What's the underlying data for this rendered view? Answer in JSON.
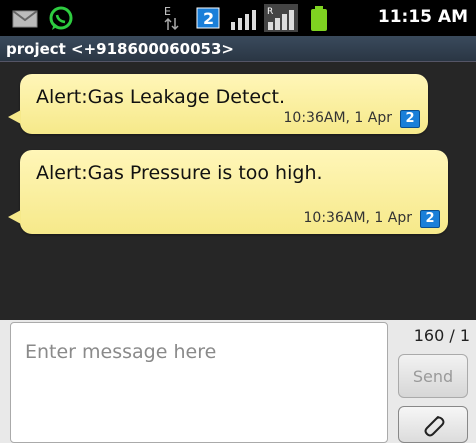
{
  "status_bar": {
    "time": "11:15 AM",
    "network_type": "E",
    "icons": [
      "email-icon",
      "whatsapp-icon",
      "edge-data-icon",
      "sim-icon",
      "signal-icon",
      "roaming-signal-icon",
      "battery-icon"
    ]
  },
  "thread": {
    "title": "project <+918600060053>"
  },
  "messages": [
    {
      "text": "Alert:Gas Leakage Detect.",
      "timestamp": "10:36AM, 1 Apr",
      "status_icon": "delivered-icon"
    },
    {
      "text": "Alert:Gas Pressure is too high.",
      "timestamp": "10:36AM, 1 Apr",
      "status_icon": "delivered-icon"
    }
  ],
  "compose": {
    "placeholder": "Enter message here",
    "value": "",
    "char_counter": "160 / 1",
    "send_label": "Send",
    "attach_icon": "paperclip-icon"
  },
  "colors": {
    "bubble": "#f6e98a",
    "background": "#262626",
    "delivered": "#1a7fd9",
    "whatsapp": "#2ecc40",
    "battery": "#7fd321"
  }
}
